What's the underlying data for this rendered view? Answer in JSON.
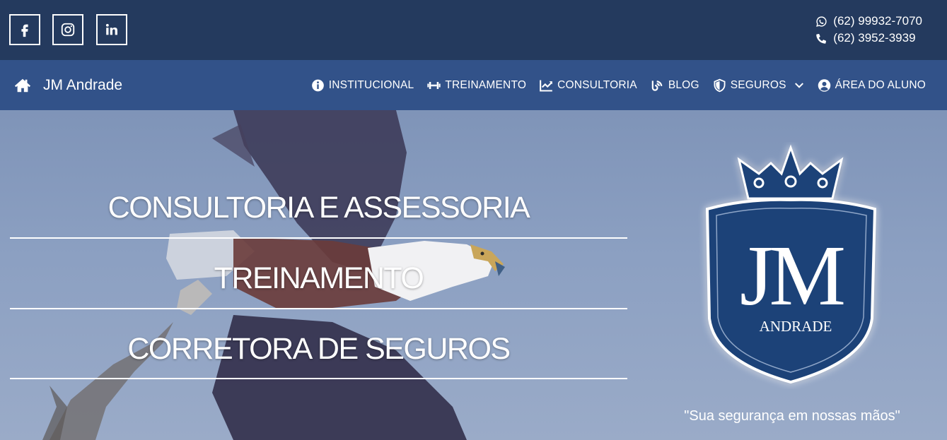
{
  "social": {
    "facebook_icon": "facebook-icon",
    "instagram_icon": "instagram-icon",
    "linkedin_icon": "linkedin-icon"
  },
  "contact": {
    "whatsapp": "(62) 99932-7070",
    "phone": "(62) 3952-3939"
  },
  "nav": {
    "brand": "JM Andrade",
    "items": [
      {
        "label": "INSTITUCIONAL",
        "icon": "info-icon"
      },
      {
        "label": "TREINAMENTO",
        "icon": "dumbbell-icon"
      },
      {
        "label": "CONSULTORIA",
        "icon": "chart-line-icon"
      },
      {
        "label": "BLOG",
        "icon": "blog-icon"
      },
      {
        "label": "SEGUROS",
        "icon": "shield-icon"
      },
      {
        "label": "ÁREA DO ALUNO",
        "icon": "user-circle-icon"
      }
    ]
  },
  "hero": {
    "lines": [
      "CONSULTORIA E ASSESSORIA",
      "TREINAMENTO",
      "CORRETORA DE SEGUROS"
    ],
    "logo": {
      "monogram": "JM",
      "name": "ANDRADE"
    },
    "slogan": "\"Sua segurança em nossas mãos\""
  },
  "colors": {
    "topbar": "#243a5e",
    "navbar": "#325289",
    "logo_blue": "#1e4378"
  }
}
